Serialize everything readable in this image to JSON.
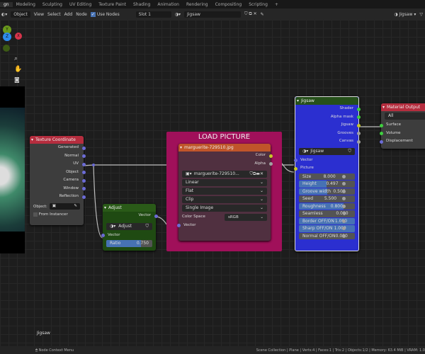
{
  "workspace_tabs": [
    "gn",
    "Modeling",
    "Sculpting",
    "UV Editing",
    "Texture Paint",
    "Shading",
    "Animation",
    "Rendering",
    "Compositing",
    "Scripting",
    "+"
  ],
  "header": {
    "object_mode": "Object",
    "menus": [
      "View",
      "Select",
      "Add",
      "Node"
    ],
    "use_nodes_label": "Use Nodes",
    "use_nodes_checked": true,
    "slot": "Slot 1",
    "material": "Jigsaw",
    "right_material": "Jigsaw"
  },
  "nav_gizmo": {
    "y": "Y",
    "x": "X",
    "z": "Z"
  },
  "nodes": {
    "texture_coordinate": {
      "title": "Texture Coordinate",
      "outputs": [
        "Generated",
        "Normal",
        "UV",
        "Object",
        "Camera",
        "Window",
        "Reflection"
      ],
      "object_label": "Object:",
      "from_instancer": "From Instancer"
    },
    "adjust": {
      "title": "Adjust",
      "output": "Vector",
      "group": "Adjust",
      "input": "Vector",
      "ratio_label": "Ratio",
      "ratio_value": "0.750",
      "ratio_fraction": 0.75
    },
    "frame": {
      "title": "LOAD PICTURE",
      "color": "#a0105a"
    },
    "image": {
      "title": "marguerite-729510.jpg",
      "outputs": [
        "Color",
        "Alpha"
      ],
      "image_name": "marguerite-729510...",
      "interpolation": "Linear",
      "projection": "Flat",
      "extension": "Clip",
      "source": "Single Image",
      "color_space_label": "Color Space",
      "color_space": "sRGB",
      "input": "Vector"
    },
    "jigsaw": {
      "title": "Jigsaw",
      "color": "#2b2fd0",
      "outputs": [
        "Shader",
        "Alpha mask",
        "Jigsaw",
        "Grooves",
        "Canvas"
      ],
      "group": "Jigsaw",
      "inputs": [
        "Vector",
        "Picture"
      ],
      "props": [
        {
          "label": "Size",
          "value": "8.000",
          "fill": 0
        },
        {
          "label": "Height",
          "value": "0.497",
          "fill": 0.497
        },
        {
          "label": "Groove width",
          "value": "0.500",
          "fill": 0.5
        },
        {
          "label": "Seed",
          "value": "5.500",
          "fill": 0
        },
        {
          "label": "Roughness",
          "value": "0.800",
          "fill": 0.8
        },
        {
          "label": "Seamless OFF/ON",
          "value": "0.000",
          "fill": 0
        },
        {
          "label": "Border OFF/ON",
          "value": "1.000",
          "fill": 1
        },
        {
          "label": "Sharp OFF/ON",
          "value": "1.000",
          "fill": 1
        },
        {
          "label": "Normal OFF/ON",
          "value": "0.000",
          "fill": 0
        }
      ]
    },
    "material_output": {
      "title": "Material Output",
      "target": "All",
      "inputs": [
        "Surface",
        "Volume",
        "Displacement"
      ]
    }
  },
  "material_name_overlay": "Jigsaw",
  "status": {
    "left": "Node Context Menu",
    "right": "Scene Collection | Plane | Verts:4 | Faces:1 | Tris:2 | Objects:1/2 | Memory: 63.4 MiB | VRAM: 1.0"
  }
}
